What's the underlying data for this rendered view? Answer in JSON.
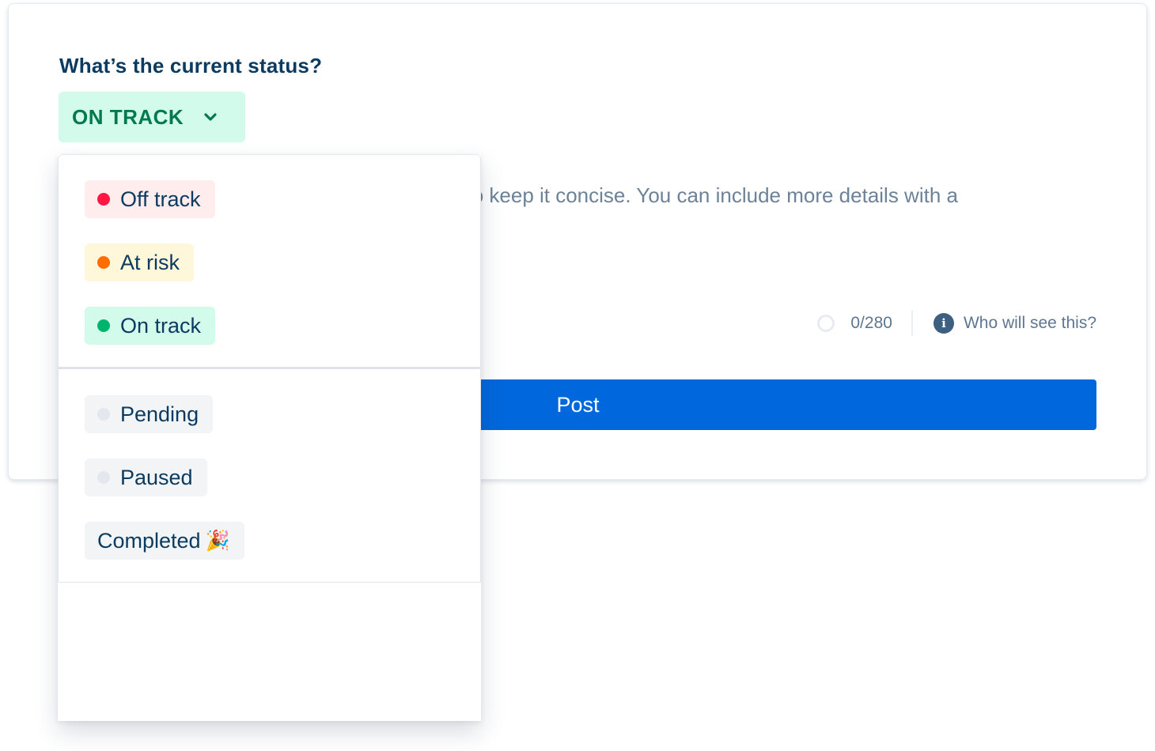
{
  "question": "What’s the current status?",
  "status_select": {
    "value": "ON TRACK",
    "bg": "#d3fbeb",
    "color": "#007a4d"
  },
  "body_text": "Status updates are shared with teammates, so keep it concise. You can include more details with a",
  "counter": {
    "value": "0/280"
  },
  "who_link": "Who will see this?",
  "post_button": "Post",
  "dropdown": {
    "group_primary": [
      {
        "label": "Off track",
        "dot": "#ff1744",
        "bg": "#ffeced"
      },
      {
        "label": "At risk",
        "dot": "#ff6d00",
        "bg": "#fff7d9"
      },
      {
        "label": "On track",
        "dot": "#00b46e",
        "bg": "#d3fbeb"
      }
    ],
    "group_secondary": [
      {
        "label": "Pending",
        "dot": "#e3e8ee",
        "bg": "#f2f4f6"
      },
      {
        "label": "Paused",
        "dot": "#e3e8ee",
        "bg": "#f2f4f6"
      },
      {
        "label": "Completed",
        "emoji": "🎉",
        "bg": "#f2f4f6"
      }
    ]
  }
}
